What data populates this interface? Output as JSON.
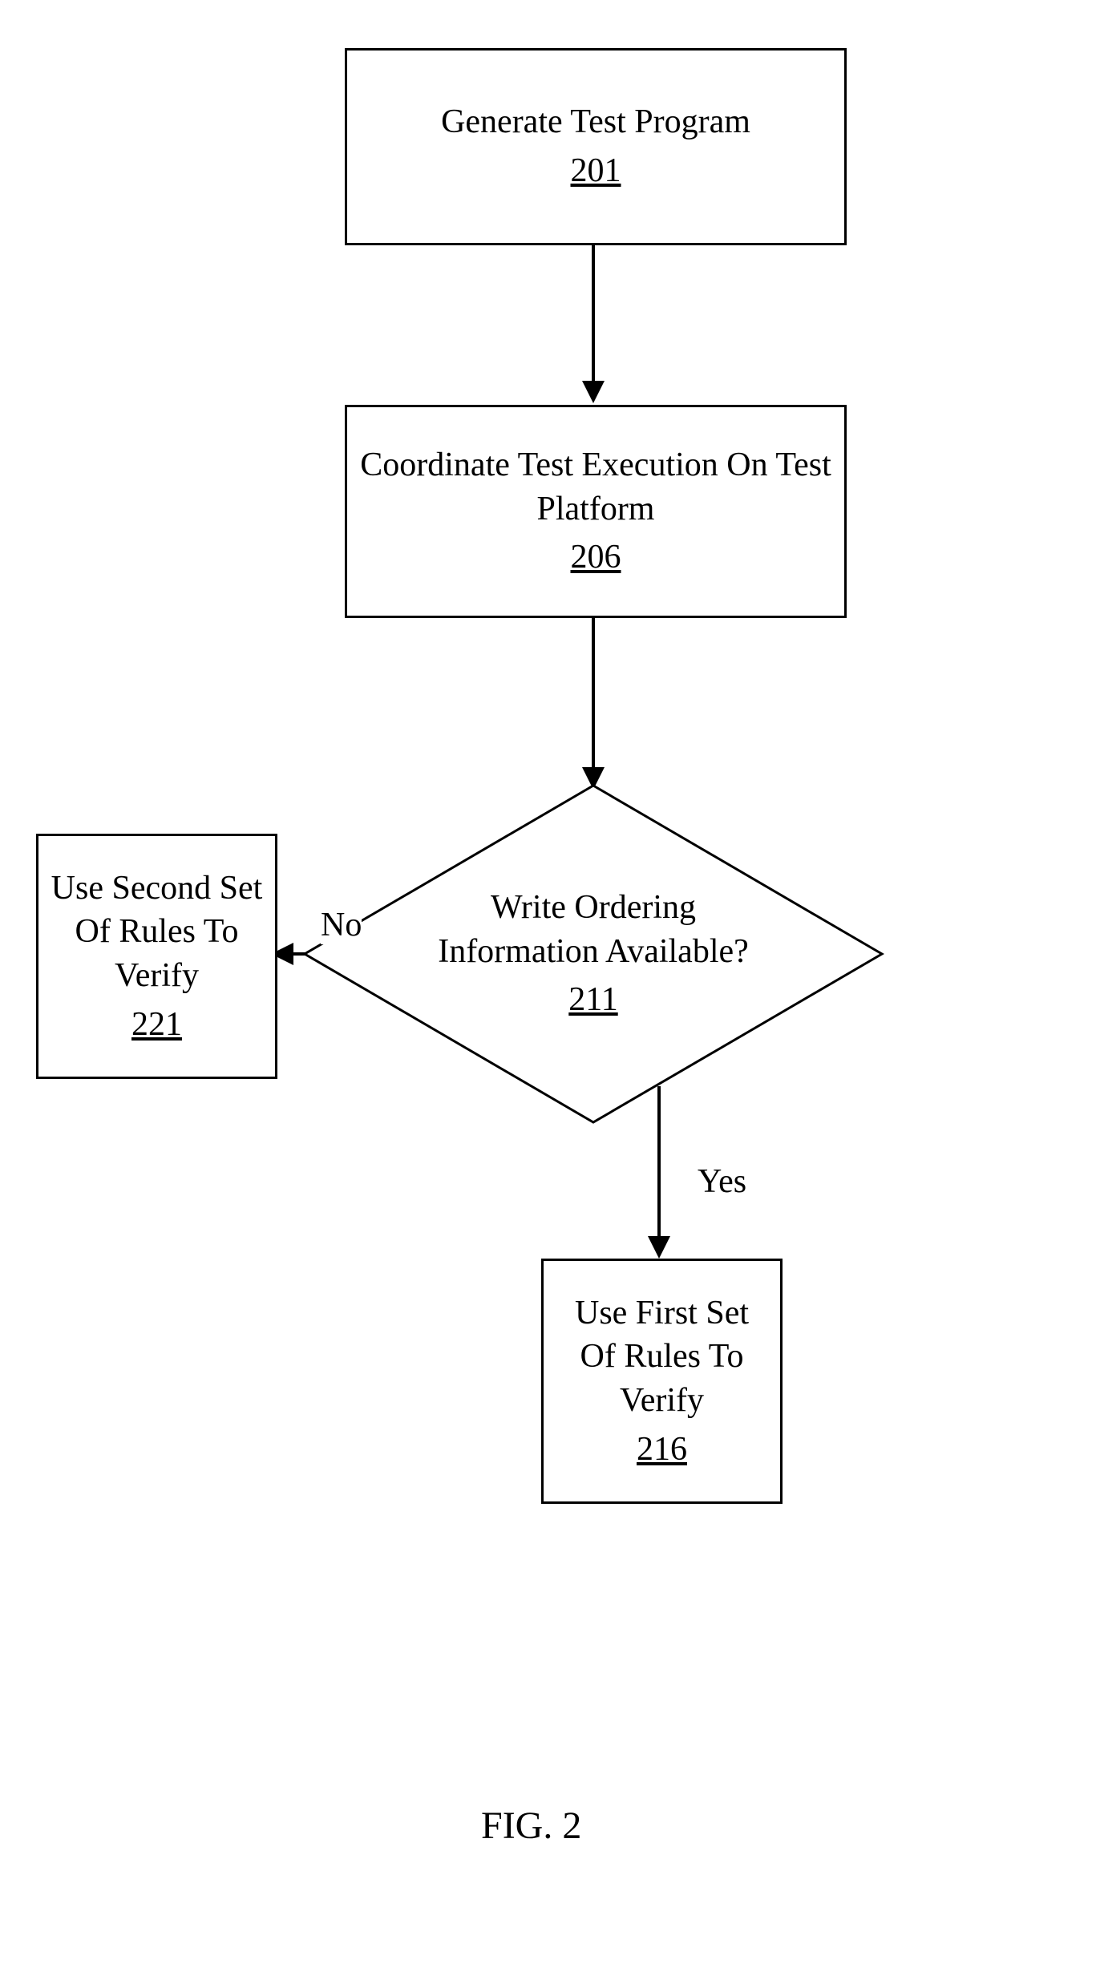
{
  "diagram": {
    "box1": {
      "text": "Generate Test Program",
      "ref": "201"
    },
    "box2": {
      "text": "Coordinate Test Execution On Test Platform",
      "ref": "206"
    },
    "decision": {
      "text": "Write Ordering Information Available?",
      "ref": "211"
    },
    "box_no": {
      "line1": "Use Second Set",
      "line2": "Of Rules To",
      "line3": "Verify",
      "ref": "221"
    },
    "box_yes": {
      "line1": "Use First Set",
      "line2": "Of Rules To",
      "line3": "Verify",
      "ref": "216"
    },
    "label_no": "No",
    "label_yes": "Yes",
    "caption": "FIG. 2"
  }
}
